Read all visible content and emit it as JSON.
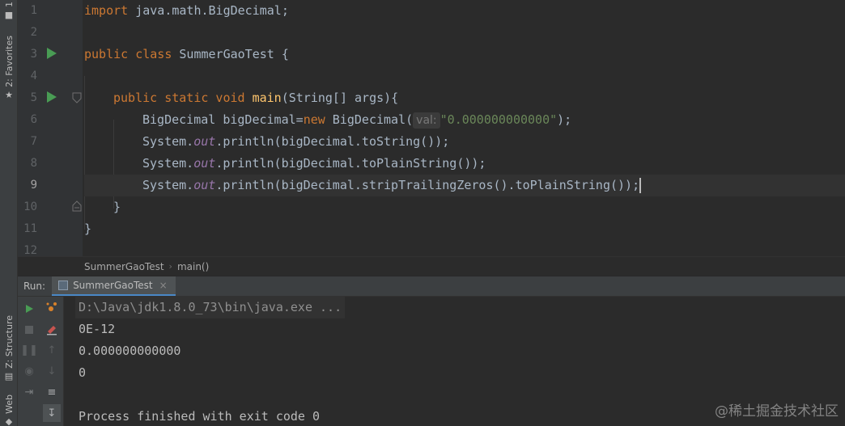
{
  "left_strip": {
    "favorites_label": "2: Favorites",
    "structure_label": "Z: Structure",
    "web_label": "Web",
    "project_label": "1"
  },
  "editor": {
    "line_numbers": [
      "1",
      "2",
      "3",
      "4",
      "5",
      "6",
      "7",
      "8",
      "9",
      "10",
      "11",
      "12"
    ],
    "hint_label": "val:"
  },
  "code": {
    "l1_kw": "import",
    "l1_rest": " java.math.BigDecimal;",
    "l3_kw": "public class",
    "l3_rest": " SummerGaoTest ",
    "l3_brace": "{",
    "l5_kw": "public static void",
    "l5_mth": "main",
    "l5_rest": "(String[] args){",
    "l6_a": "BigDecimal bigDecimal=",
    "l6_kw": "new",
    "l6_b": " BigDecimal(",
    "l6_str": "\"0.000000000000\"",
    "l6_c": ");",
    "l7_a": "System.",
    "l7_fld": "out",
    "l7_b": ".println(bigDecimal.toString());",
    "l8_a": "System.",
    "l8_fld": "out",
    "l8_b": ".println(bigDecimal.toPlainString());",
    "l9_a": "System.",
    "l9_fld": "out",
    "l9_b": ".println(bigDecimal.stripTrailingZeros().toPlainString());",
    "l10": "}",
    "l11": "}"
  },
  "breadcrumb": {
    "class": "SummerGaoTest",
    "method": "main()"
  },
  "run": {
    "label": "Run:",
    "tab": "SummerGaoTest",
    "close": "×"
  },
  "console": {
    "lines": [
      "D:\\Java\\jdk1.8.0_73\\bin\\java.exe ...",
      "0E-12",
      "0.000000000000",
      "0",
      "",
      "Process finished with exit code 0"
    ]
  },
  "watermark": "@稀土掘金技术社区",
  "colors": {
    "keyword": "#cc7832",
    "string": "#6a8759",
    "field": "#9876aa",
    "method": "#ffc66d",
    "run_green": "#499c54"
  }
}
